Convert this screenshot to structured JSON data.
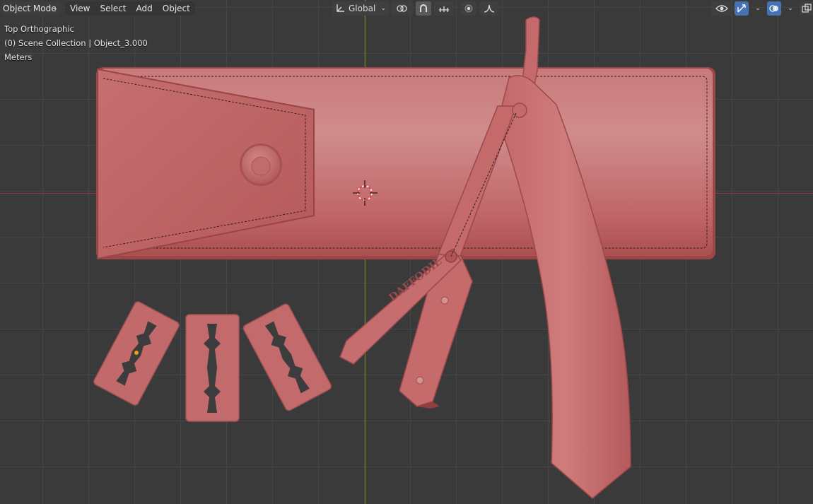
{
  "header": {
    "mode": "Object Mode",
    "menus": [
      "View",
      "Select",
      "Add",
      "Object"
    ],
    "transform_orientation": "Global"
  },
  "overlay": {
    "view_name": "Top Orthographic",
    "collection": "(0) Scene Collection | Object_3.000",
    "units": "Meters"
  },
  "scene": {
    "objects": [
      "case-pouch",
      "straight-razor",
      "razor-blade-1",
      "razor-blade-2",
      "razor-blade-3"
    ],
    "engraving": "DAFFODIL",
    "colors": {
      "clay": "#c4686a",
      "grid": "#3a3a3a",
      "x_axis": "#8c3a3e",
      "y_axis": "#6f8a22",
      "active_toggle": "#4772b3"
    }
  },
  "icons": [
    "chevron-down-icon",
    "transform-orientation-icon",
    "pivot-icon",
    "snap-icon",
    "snap-target-icon",
    "proportional-edit-icon",
    "falloff-icon",
    "visibility-icon",
    "gizmo-icon",
    "overlay-icon",
    "xray-icon",
    "3d-cursor-icon"
  ]
}
